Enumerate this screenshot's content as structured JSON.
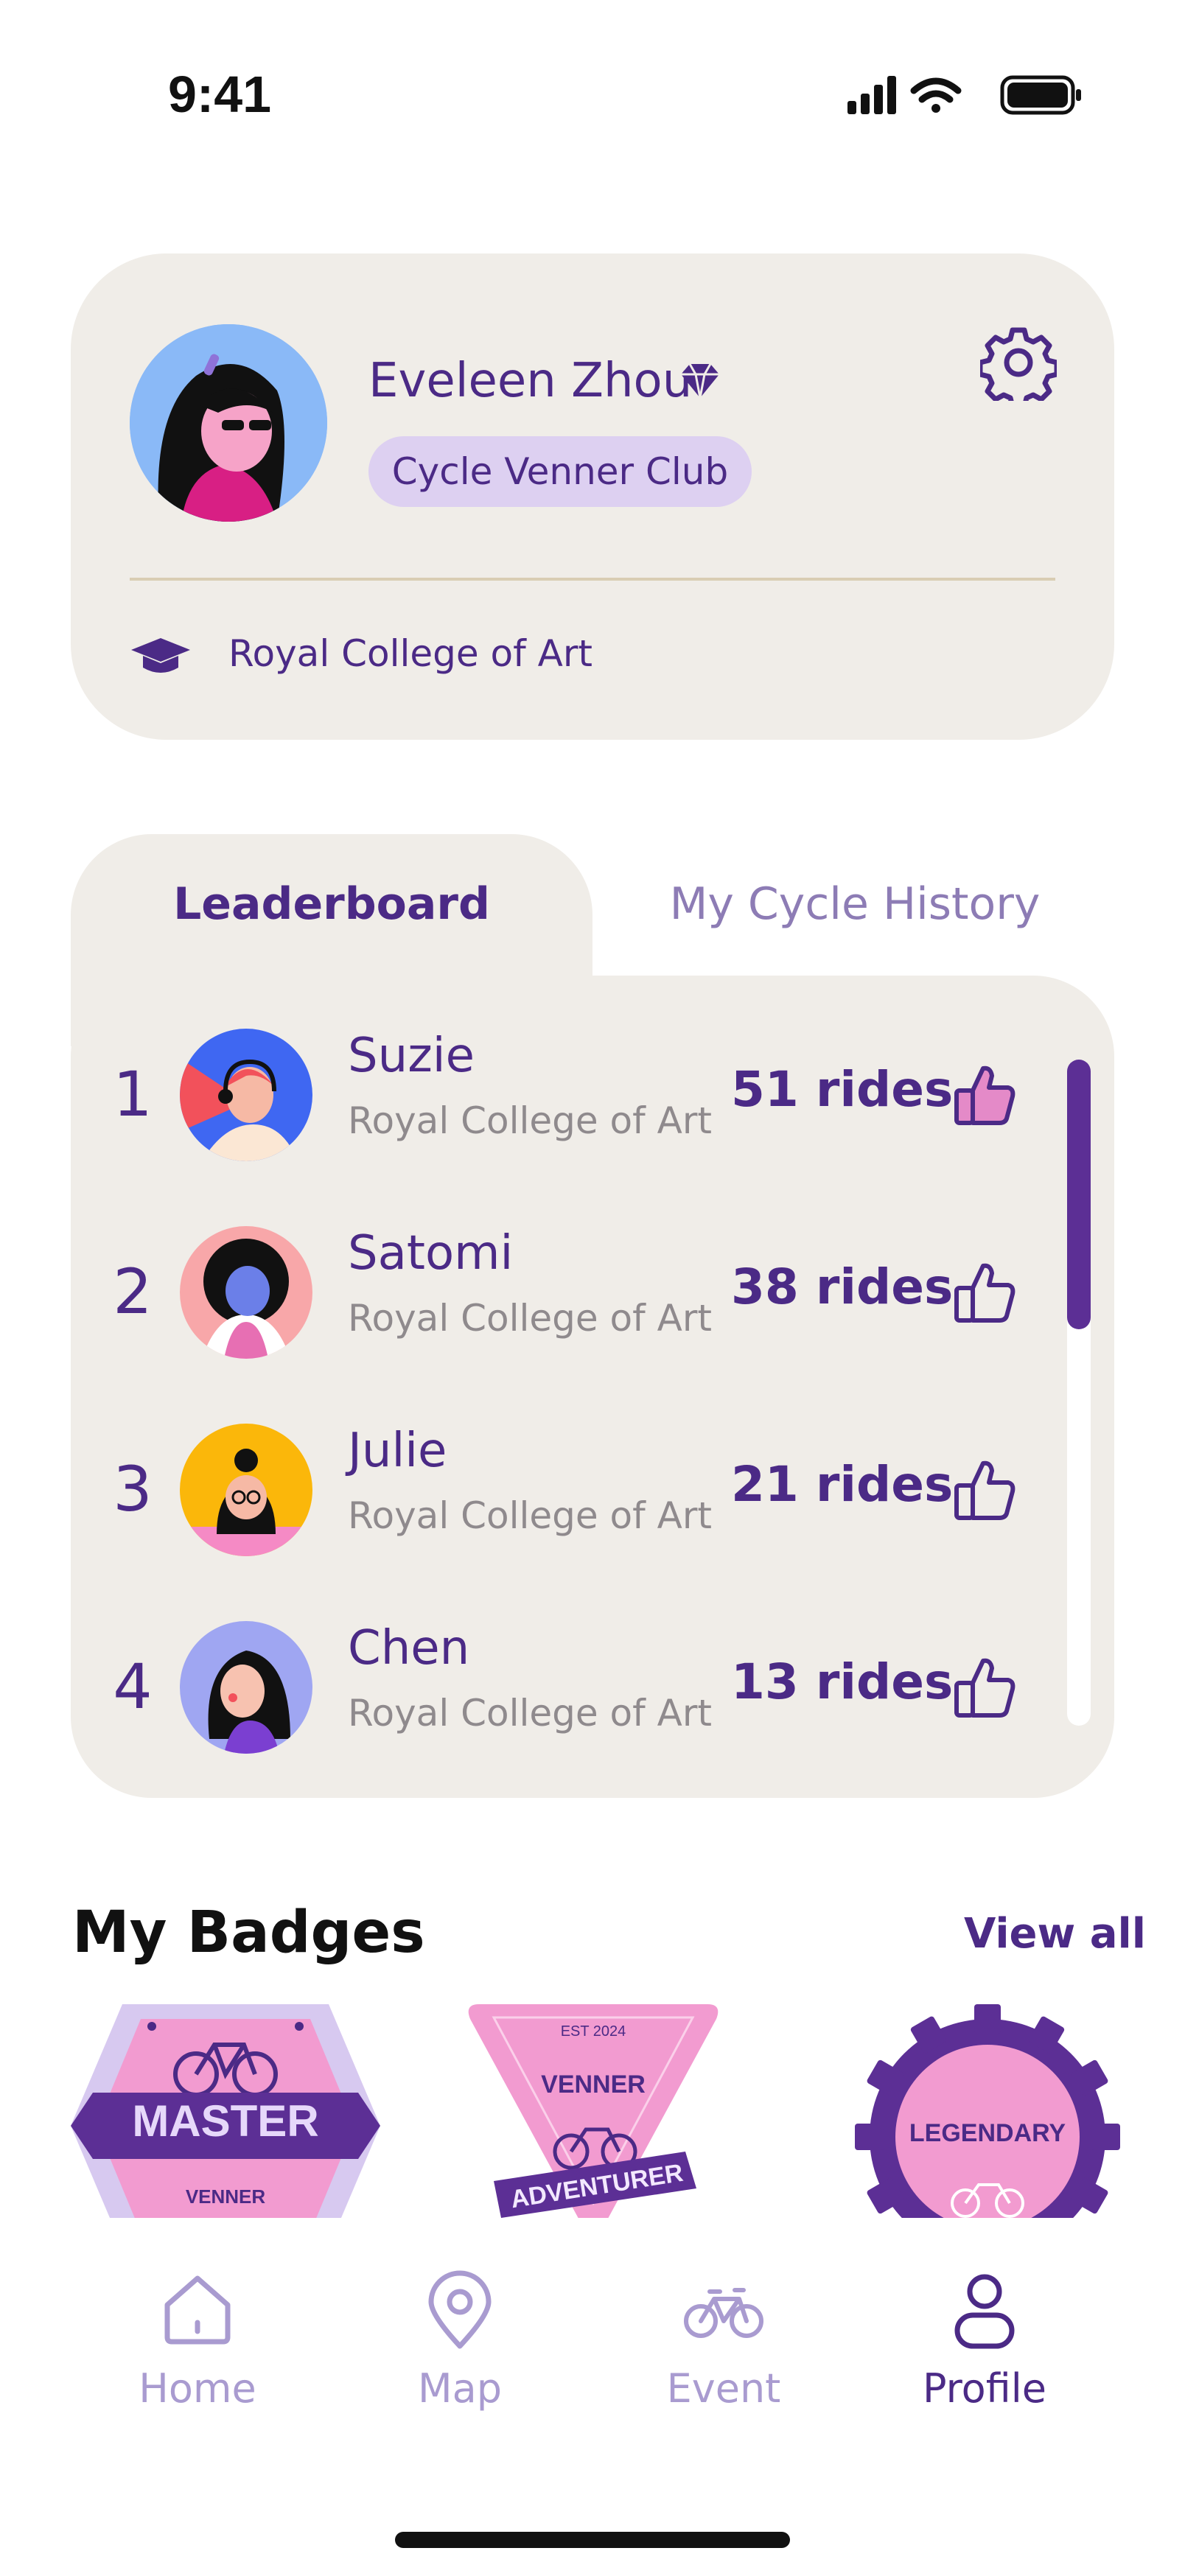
{
  "status_bar": {
    "time": "9:41"
  },
  "profile": {
    "name": "Eveleen Zhou",
    "club": "Cycle Venner Club",
    "school": "Royal College of Art"
  },
  "tabs": [
    {
      "label": "Leaderboard",
      "active": true
    },
    {
      "label": "My Cycle History",
      "active": false
    }
  ],
  "leaderboard": [
    {
      "rank": "1",
      "name": "Suzie",
      "school": "Royal College of Art",
      "rides": "51 rides",
      "liked": true
    },
    {
      "rank": "2",
      "name": "Satomi",
      "school": "Royal College of Art",
      "rides": "38 rides",
      "liked": false
    },
    {
      "rank": "3",
      "name": "Julie",
      "school": "Royal College of Art",
      "rides": "21 rides",
      "liked": false
    },
    {
      "rank": "4",
      "name": "Chen",
      "school": "Royal College of Art",
      "rides": "13 rides",
      "liked": false
    }
  ],
  "badges": {
    "title": "My Badges",
    "view_all": "View all",
    "items": [
      {
        "title": "MASTER",
        "subtitle": "VENNER"
      },
      {
        "top": "EST 2024",
        "title": "VENNER",
        "ribbon": "ADVENTURER"
      },
      {
        "title": "LEGENDARY"
      }
    ]
  },
  "nav": [
    {
      "label": "Home",
      "icon": "home-icon",
      "active": false
    },
    {
      "label": "Map",
      "icon": "map-pin-icon",
      "active": false
    },
    {
      "label": "Event",
      "icon": "bike-icon",
      "active": false
    },
    {
      "label": "Profile",
      "icon": "profile-icon",
      "active": true
    }
  ],
  "colors": {
    "primary": "#4b2a86",
    "card": "#f0ede8",
    "pill": "#ddd0f1",
    "muted": "#8d7cb5",
    "accent_pink": "#e48ac8"
  }
}
